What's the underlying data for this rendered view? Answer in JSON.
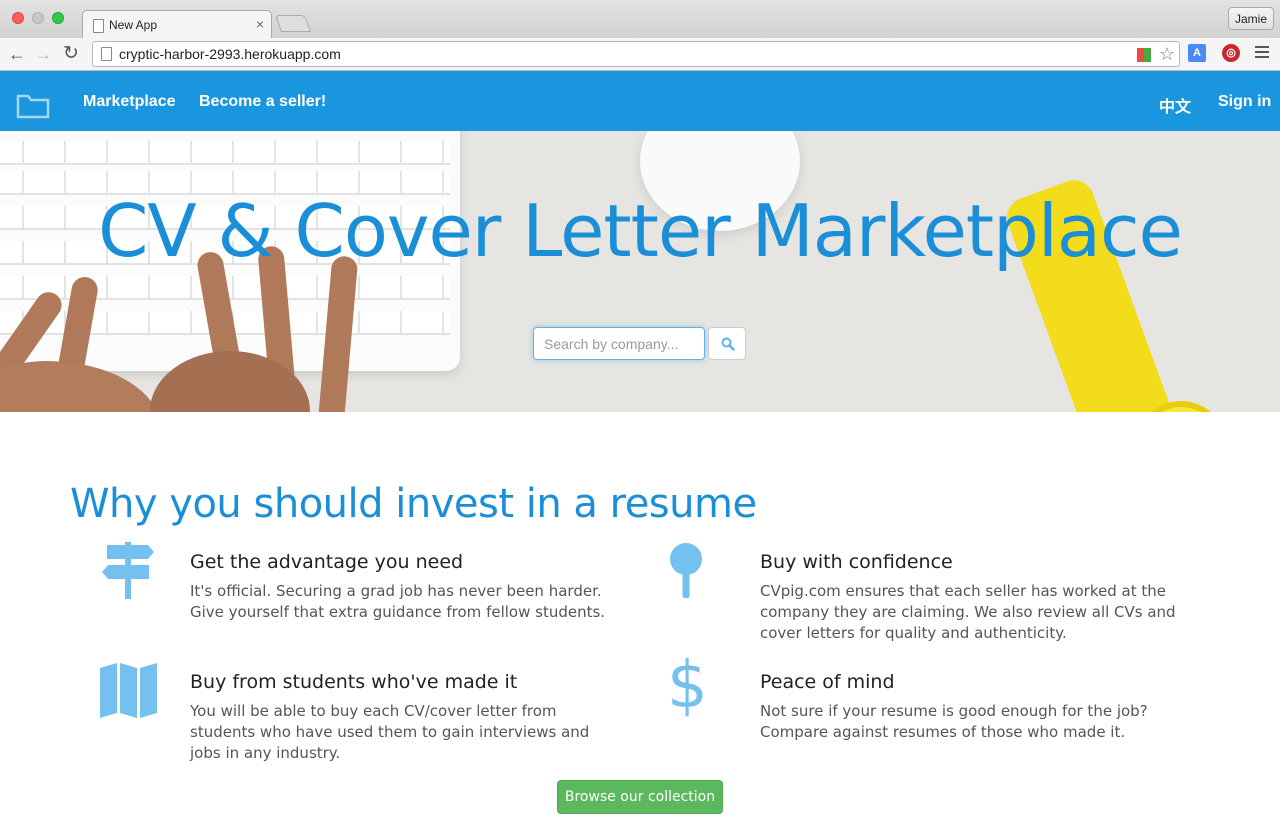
{
  "browser": {
    "tab_title": "New App",
    "tab_close": "×",
    "profile_name": "Jamie",
    "url": "cryptic-harbor-2993.herokuapp.com",
    "nav_icons": [
      "back-arrow-icon",
      "forward-arrow-icon",
      "reload-icon",
      "star-icon",
      "translate-icon",
      "ublock-icon",
      "menu-icon"
    ],
    "glyphs": {
      "back": "←",
      "forward": "→",
      "reload": "↻",
      "star": "☆",
      "translate": "A",
      "ublock": "◎"
    }
  },
  "navbar": {
    "brand_icon": "folder-icon",
    "links": [
      "Marketplace",
      "Become a seller!"
    ],
    "language": "中文",
    "signin": "Sign in",
    "background": "#1a96df"
  },
  "hero": {
    "title": "CV & Cover Letter Marketplace",
    "search_placeholder": "Search by company...",
    "search_icon": "search-icon"
  },
  "features": {
    "title": "Why you should invest in a resume",
    "items": [
      {
        "icon": "signpost-icon",
        "heading": "Get the advantage you need",
        "text": "It's official. Securing a grad job has never been harder. Give yourself that extra guidance from fellow students."
      },
      {
        "icon": "magnifier-icon",
        "heading": "Buy with confidence",
        "text": "CVpig.com ensures that each seller has worked at the company they are claiming. We also review all CVs and cover letters for quality and authenticity."
      },
      {
        "icon": "map-icon",
        "heading": "Buy from students who've made it",
        "text": "You will be able to buy each CV/cover letter from students who have used them to gain interviews and jobs in any industry."
      },
      {
        "icon": "dollar-icon",
        "heading": "Peace of mind",
        "text": "Not sure if your resume is good enough for the job? Compare against resumes of those who made it."
      }
    ],
    "icon_color": "#74c0ee",
    "browse_button": "Browse our collection",
    "dollar_glyph": "$"
  },
  "colors": {
    "accent": "#1a8fd8",
    "success": "#5cb85c"
  }
}
